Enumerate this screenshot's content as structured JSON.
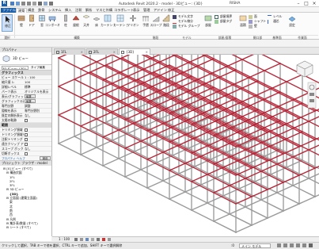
{
  "window": {
    "title": "Autodesk Revit 2020.2 - model - 3Dビュー: {3D}",
    "user": "RISHA",
    "app_icon": "R"
  },
  "ribbon_tabs": [
    "ファイル",
    "建築",
    "構造",
    "鉄骨",
    "システム",
    "挿入",
    "注釈",
    "解析",
    "マスと外構",
    "コラボレート",
    "表示",
    "管理",
    "アドイン",
    "修正"
  ],
  "ribbon": {
    "modify": "修正",
    "wall": "壁",
    "door": "ドア",
    "window": "窓",
    "component": "コンポーネント",
    "column": "柱",
    "roof": "屋根",
    "ceiling": "天井",
    "floor": "床",
    "curtain_system": "カーテン システム",
    "curtain_grid": "カーテン グリッド",
    "mullion": "マリオン",
    "railing": "手摺",
    "ramp": "スロープ",
    "stair": "階段",
    "model_text": "モデル文字",
    "model_line": "モデル線分",
    "model_group": "モデル グループ",
    "room": "部屋",
    "room_separator": "部屋境界",
    "tag_room": "部屋タグ",
    "area": "面積",
    "area_boundary": "面積境界",
    "tag_area": "面積タグ",
    "by_face": "面",
    "shaft": "シャフト",
    "wall_opening": "壁",
    "vertical": "垂直",
    "dormer": "ドーマー",
    "level": "レベル",
    "grid": "通芯",
    "set": "設定",
    "panels": [
      "選択",
      "構築",
      "階段",
      "モデル",
      "部屋/面積",
      "開口部",
      "基準面",
      "作業面"
    ]
  },
  "properties": {
    "header": "プロパティ",
    "type_name": "3D ビュー",
    "type_select": "3D ビュー: {3D}",
    "edit_type": "タイプ編集",
    "groups": {
      "graphics": "グラフィックス",
      "extents": "範囲",
      "camera": "カメラ"
    },
    "rows": [
      {
        "k": "ビュー スケール",
        "v": "1 : 100"
      },
      {
        "k": "縮尺値 1:",
        "v": "100"
      },
      {
        "k": "詳細レベル",
        "v": "標準"
      },
      {
        "k": "パーツ表示",
        "v": "オリジナルを表示"
      },
      {
        "k": "表示/グラフィックス",
        "v": "編集..."
      },
      {
        "k": "グラフィックス表示",
        "v": "編集..."
      },
      {
        "k": "専門分野",
        "v": "調整"
      },
      {
        "k": "隠線を表示",
        "v": "専門分野別"
      },
      {
        "k": "既定の解析表示",
        "v": "なし"
      },
      {
        "k": "太陽の軌跡",
        "v": ""
      }
    ],
    "extent_rows": [
      {
        "k": "トリミング領域",
        "v": ""
      },
      {
        "k": "トリミング領域を表示",
        "v": ""
      },
      {
        "k": "注釈トリミング",
        "v": ""
      },
      {
        "k": "遠方クリップ アクティブ",
        "v": ""
      },
      {
        "k": "スコープ ボックス",
        "v": "なし"
      },
      {
        "k": "切断ボックス",
        "v": ""
      }
    ],
    "help_link": "プロパティ ヘルプ",
    "apply": "適用"
  },
  "project_browser": {
    "header": "プロジェクト ブラウザ - model",
    "items": [
      "[0] ビュー (すべて)",
      "構造伏図",
      "1FL",
      "2FL",
      "3FL",
      "3D ビュー",
      "{3D}",
      "立面図 (建築立面図)",
      "東",
      "北",
      "南",
      "西",
      "凡例",
      "集計表/数量 (すべて)",
      "シート (すべて)"
    ]
  },
  "view_tabs": [
    {
      "label": "1FL",
      "active": false
    },
    {
      "label": "2FL",
      "active": false
    },
    {
      "label": "{3D}",
      "active": true
    }
  ],
  "view_nav": {
    "scale": "1 : 100"
  },
  "status": {
    "message": "クリックして選択、TAB キーで他を選択、CTRL キーで追加、SHIFT キーで選択解除",
    "zero": ":0",
    "model": "メイン モデル"
  },
  "colors": {
    "accent": "#1b5ea8",
    "beam_red": "#b8283a",
    "frame_gray": "#9a9a9a"
  }
}
